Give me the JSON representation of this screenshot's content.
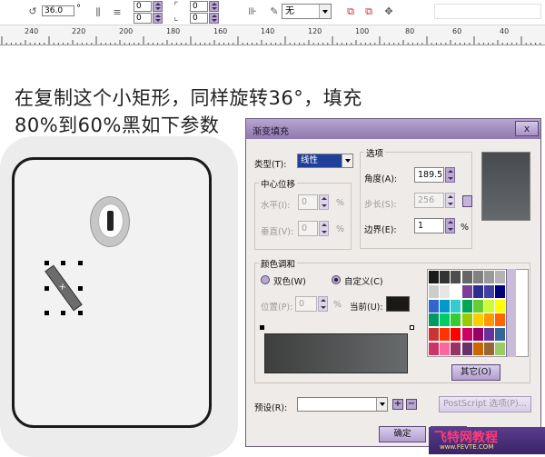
{
  "propbar": {
    "rotation_value": "36.0",
    "degree_symbol": "°",
    "fill_combo_value": "无"
  },
  "ruler": {
    "ticks": [
      "240",
      "220",
      "200",
      "180",
      "160",
      "140",
      "120",
      "100",
      "80",
      "60",
      "40"
    ]
  },
  "instructions": {
    "line1": "在复制这个小矩形，同样旋转36°，填充",
    "line2": "80%到60%黑如下参数"
  },
  "dialog": {
    "title": "渐变填充",
    "close_label": "x",
    "type_label": "类型(T):",
    "type_value": "线性",
    "center_group": "中心位移",
    "horizontal_label": "水平(I):",
    "horizontal_value": "0",
    "vertical_label": "垂直(V):",
    "vertical_value": "0",
    "percent": "%",
    "options_group": "选项",
    "angle_label": "角度(A):",
    "angle_value": "189.5",
    "steps_label": "步长(S):",
    "steps_value": "256",
    "edge_label": "边界(E):",
    "edge_value": "1",
    "blend_group": "颜色调和",
    "two_color_label": "双色(W)",
    "custom_label": "自定义(C)",
    "position_label": "位置(P):",
    "position_value": "0",
    "current_label": "当前(U):",
    "current_color": "#1b1916",
    "other_button": "其它(O)",
    "preset_label": "预设(R):",
    "postscript_button": "PostScript 选项(P)...",
    "ok_button": "确定",
    "cancel_button": "取",
    "palette_colors": [
      [
        "#1a1a1a",
        "#333333",
        "#4d4d4d",
        "#666666",
        "#808080",
        "#999999",
        "#b3b3b3"
      ],
      [
        "#cccccc",
        "#e6e6e6",
        "#ffffff",
        "#7b3f99",
        "#2d2d8c",
        "#3f3fa6",
        "#00007a"
      ],
      [
        "#3366cc",
        "#0099cc",
        "#33cccc",
        "#00a651",
        "#66cc33",
        "#ccff33",
        "#ffff00"
      ],
      [
        "#009966",
        "#00cc66",
        "#33cc33",
        "#99cc00",
        "#ffcc00",
        "#ff9900",
        "#ff6600"
      ],
      [
        "#cc3333",
        "#ff3300",
        "#ff0000",
        "#cc0066",
        "#990066",
        "#663399",
        "#336699"
      ],
      [
        "#cc3366",
        "#ff6699",
        "#993366",
        "#663366",
        "#cc6600",
        "#996633",
        "#99cc66"
      ]
    ]
  },
  "watermark": {
    "text": "飞特网教程",
    "sub": "www.FEVTE.COM"
  }
}
